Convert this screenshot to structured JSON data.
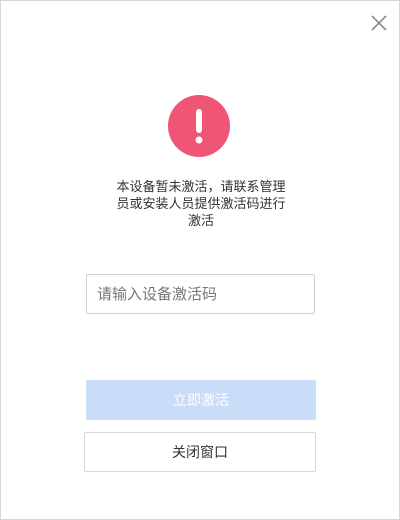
{
  "dialog": {
    "message_lines": [
      "本设备暂未激活，请联系管理",
      "员或安装人员提供激活码进行",
      "激活"
    ],
    "alert_icon": "exclamation-icon",
    "alert_color": "#ef5574",
    "close_icon": "close-icon"
  },
  "activation_input": {
    "value": "",
    "placeholder": "请输入设备激活码"
  },
  "buttons": {
    "activate_label": "立即激活",
    "activate_color": "#c9dcf8",
    "close_window_label": "关闭窗口"
  }
}
